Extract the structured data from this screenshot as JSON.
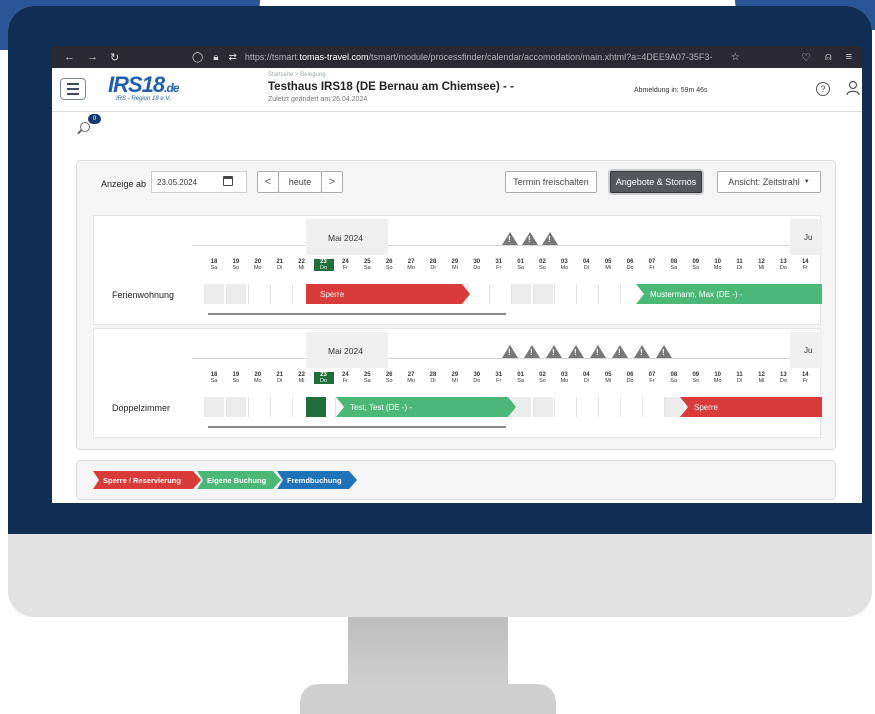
{
  "browser": {
    "url_prefix": "https://tsmart.",
    "url_domain": "tomas-travel.com",
    "url_rest": "/tsmart/module/processfinder/calendar/accomodation/main.xhtml?a=4DEE9A07-35F3-"
  },
  "header": {
    "logo_main": "IRS18",
    "logo_suffix": ".de",
    "logo_sub": "IRS - Region 18 e.V.",
    "breadcrumb": "Startseite  >  Belegung",
    "title": "Testhaus IRS18 (DE Bernau am Chiemsee) - -",
    "subtitle": "Zuletzt geändert am 26.04.2024",
    "logout_info": "Abmeldung in: 59m 46s",
    "search_badge": "0"
  },
  "toolbar": {
    "from_label": "Anzeige ab",
    "from_value": "23.05.2024",
    "today_label": "heute",
    "prev_symbol": "<",
    "next_symbol": ">",
    "unlock_label": "Termin freischalten",
    "offers_label": "Angebote & Stornos",
    "view_label": "Ansicht: Zeitstrahl"
  },
  "calendar": {
    "month": "Mai 2024",
    "next_month_cut": "Ju",
    "days": [
      {
        "d": "18",
        "w": "Sa"
      },
      {
        "d": "19",
        "w": "So"
      },
      {
        "d": "20",
        "w": "Mo"
      },
      {
        "d": "21",
        "w": "Di"
      },
      {
        "d": "22",
        "w": "Mi"
      },
      {
        "d": "23",
        "w": "Do"
      },
      {
        "d": "24",
        "w": "Fr"
      },
      {
        "d": "25",
        "w": "Sa"
      },
      {
        "d": "26",
        "w": "So"
      },
      {
        "d": "27",
        "w": "Mo"
      },
      {
        "d": "28",
        "w": "Di"
      },
      {
        "d": "29",
        "w": "Mi"
      },
      {
        "d": "30",
        "w": "Do"
      },
      {
        "d": "31",
        "w": "Fr"
      },
      {
        "d": "01",
        "w": "Sa"
      },
      {
        "d": "02",
        "w": "So"
      },
      {
        "d": "03",
        "w": "Mo"
      },
      {
        "d": "04",
        "w": "Di"
      },
      {
        "d": "05",
        "w": "Mi"
      },
      {
        "d": "06",
        "w": "Do"
      },
      {
        "d": "07",
        "w": "Fr"
      },
      {
        "d": "08",
        "w": "Sa"
      },
      {
        "d": "09",
        "w": "So"
      },
      {
        "d": "10",
        "w": "Mo"
      },
      {
        "d": "11",
        "w": "Di"
      },
      {
        "d": "12",
        "w": "Mi"
      },
      {
        "d": "13",
        "w": "Do"
      },
      {
        "d": "14",
        "w": "Fr"
      }
    ],
    "rooms": [
      {
        "name": "Ferienwohnung",
        "bookings": [
          {
            "label": "Sperre",
            "type": "block"
          },
          {
            "label": "Mustermann, Max (DE -) -",
            "type": "own"
          }
        ]
      },
      {
        "name": "Doppelzimmer",
        "bookings": [
          {
            "label": "Test, Test (DE -) -",
            "type": "own"
          },
          {
            "label": "Sperre",
            "type": "block"
          }
        ]
      }
    ]
  },
  "legend": {
    "block": "Sperre / Reservierung",
    "own": "Eigene Buchung",
    "external": "Fremdbuchung"
  },
  "colors": {
    "block": "#d93a3a",
    "own": "#4cb877",
    "external": "#1f72b8",
    "today": "#216e3a"
  }
}
